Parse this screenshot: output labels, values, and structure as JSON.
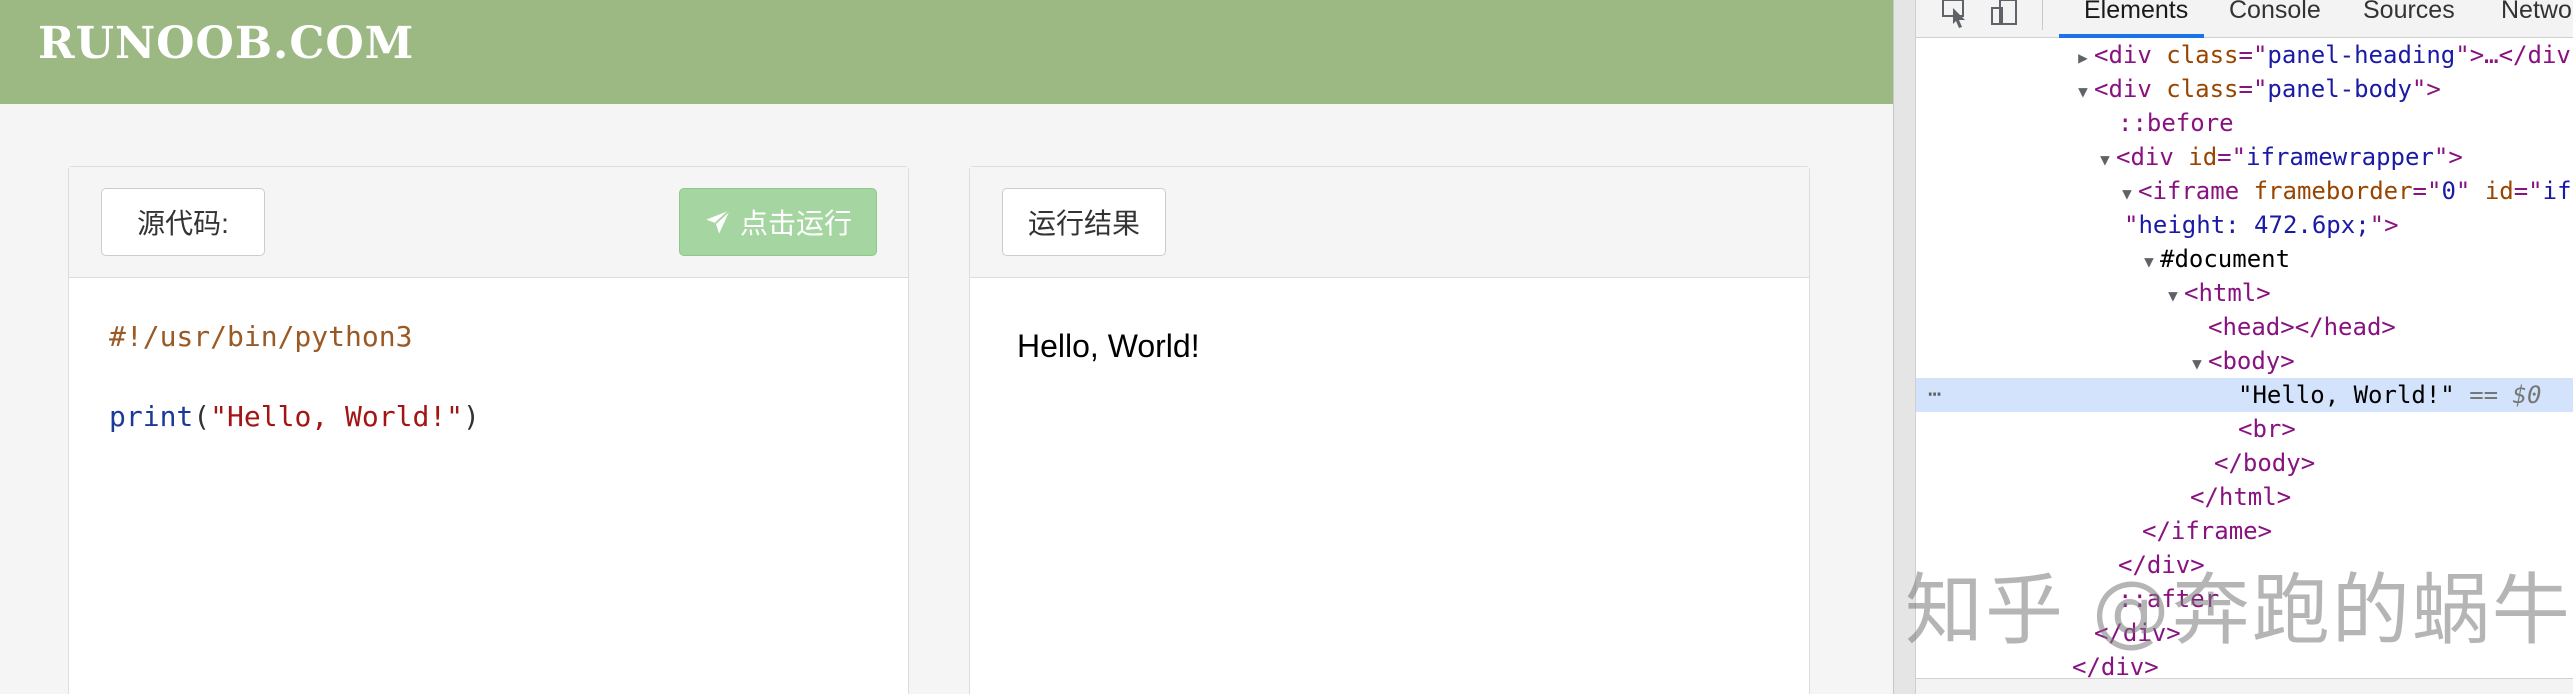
{
  "site": {
    "logo": "RUNOOB.COM"
  },
  "editor": {
    "source_label": "源代码:",
    "run_label": "点击运行",
    "code_comment": "#!/usr/bin/python3",
    "code_fn": "print",
    "code_open": "(",
    "code_string": "\"Hello, World!\"",
    "code_close": ")"
  },
  "result": {
    "label": "运行结果",
    "output": "Hello, World!"
  },
  "devtools": {
    "tabs": [
      "Elements",
      "Console",
      "Sources",
      "Network"
    ],
    "active_tab": "Elements",
    "colors": {
      "selection": "#d3e3fc",
      "accent": "#1a73e8"
    },
    "dom": {
      "l1_tag_open": "<div ",
      "l1_attr": "class",
      "l1_eq": "=\"",
      "l1_val": "panel-heading",
      "l1_rest": "\">…</div",
      "l2_tag_open": "<div ",
      "l2_attr": "class",
      "l2_eq": "=\"",
      "l2_val": "panel-body",
      "l2_rest": "\">",
      "l3_pseudo": "::before",
      "l4_tag_open": "<div ",
      "l4_attr": "id",
      "l4_eq": "=\"",
      "l4_val": "iframewrapper",
      "l4_rest": "\">",
      "l5_tag_open": "<iframe ",
      "l5_attr1": "frameborder",
      "l5_eq1": "=\"",
      "l5_val1": "0",
      "l5_sep": "\" ",
      "l5_attr2": "id",
      "l5_eq2": "=\"",
      "l5_val2": "if",
      "l6_val": "height: 472.6px;",
      "l6_rest": "\">",
      "l7": "#document",
      "l8": "<html>",
      "l9": "<head></head>",
      "l10": "<body>",
      "l11_text": "\"Hello, World!\"",
      "l11_eq": "== $0",
      "l12": "<br>",
      "l13": "</body>",
      "l14": "</html>",
      "l15": "</iframe>",
      "l16": "</div>",
      "l17": "::after",
      "l18": "</div>",
      "l19": "</div>"
    }
  },
  "watermark": "知乎 @奔跑的蜗牛"
}
